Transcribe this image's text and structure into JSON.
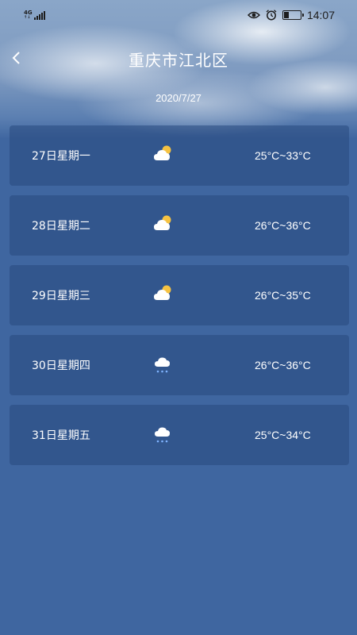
{
  "status_bar": {
    "network": "4G",
    "time": "14:07",
    "icons": [
      "signal-icon",
      "eye-icon",
      "alarm-icon",
      "battery-icon"
    ]
  },
  "header": {
    "title": "重庆市江北区",
    "date": "2020/7/27"
  },
  "forecast": [
    {
      "day": "27日星期一",
      "temp": "25°C~33°C",
      "icon": "partly-cloudy-icon"
    },
    {
      "day": "28日星期二",
      "temp": "26°C~36°C",
      "icon": "partly-cloudy-icon"
    },
    {
      "day": "29日星期三",
      "temp": "26°C~35°C",
      "icon": "partly-cloudy-icon"
    },
    {
      "day": "30日星期四",
      "temp": "26°C~36°C",
      "icon": "cloud-rain-icon"
    },
    {
      "day": "31日星期五",
      "temp": "25°C~34°C",
      "icon": "cloud-rain-icon"
    }
  ],
  "colors": {
    "background": "#3f66a0",
    "card": "#2f5288",
    "sun": "#f5c242",
    "rain": "#7fb3ff"
  }
}
